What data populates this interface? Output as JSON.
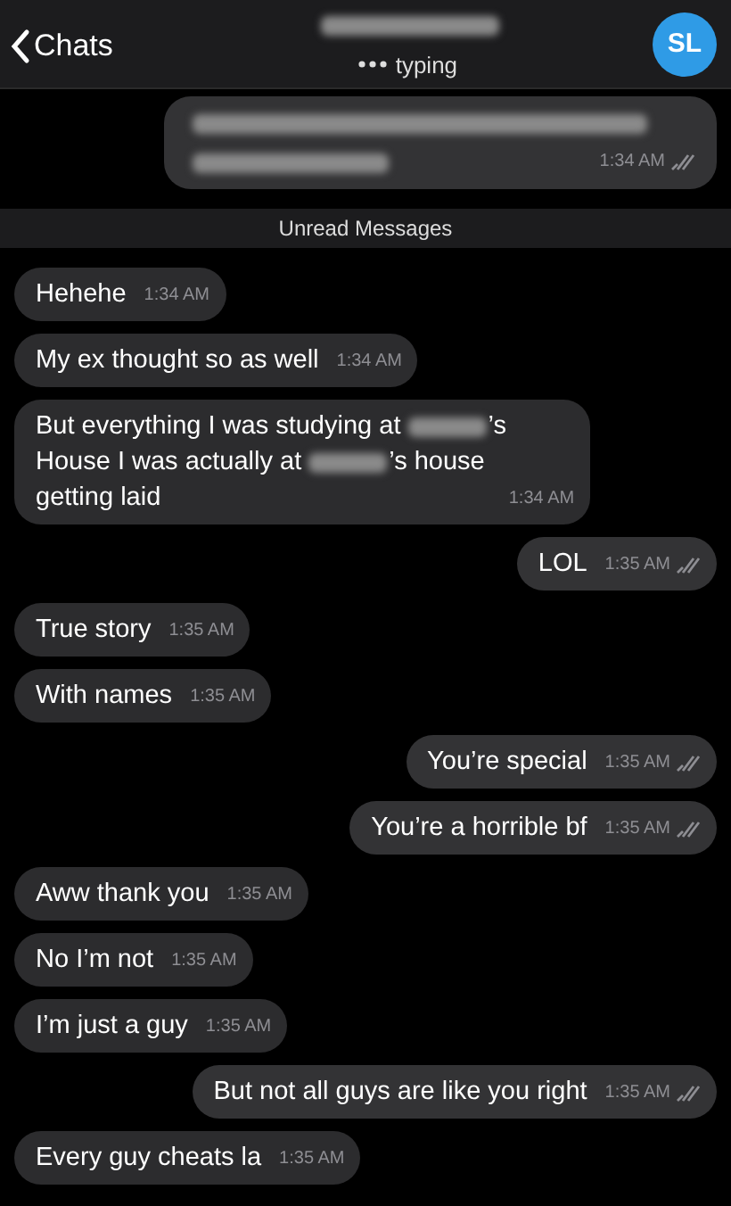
{
  "header": {
    "back_label": "Chats",
    "title": {
      "kind": "redacted"
    },
    "status": "typing",
    "avatar": {
      "initials": "SL",
      "color": "#2f9be6"
    }
  },
  "messages": [
    {
      "kind": "outgoing",
      "parts": [
        {
          "kind": "redacted"
        },
        {
          "kind": "redacted"
        }
      ],
      "time": "1:34 AM",
      "read": true
    },
    {
      "kind": "divider",
      "text": "Unread Messages"
    },
    {
      "kind": "incoming",
      "parts": [
        {
          "kind": "text",
          "text": "Hehehe"
        }
      ],
      "time": "1:34 AM"
    },
    {
      "kind": "incoming",
      "parts": [
        {
          "kind": "text",
          "text": "My ex thought so as well"
        }
      ],
      "time": "1:34 AM"
    },
    {
      "kind": "incoming",
      "parts": [
        {
          "kind": "text",
          "text": "But everything I was studying at"
        },
        {
          "kind": "redacted"
        },
        {
          "kind": "text",
          "text": "’s"
        },
        {
          "kind": "text",
          "text": "House I was actually at"
        },
        {
          "kind": "redacted"
        },
        {
          "kind": "text",
          "text": "’s house"
        },
        {
          "kind": "text",
          "text": "getting laid"
        }
      ],
      "time": "1:34 AM"
    },
    {
      "kind": "outgoing",
      "parts": [
        {
          "kind": "text",
          "text": "LOL"
        }
      ],
      "time": "1:35 AM",
      "read": true
    },
    {
      "kind": "incoming",
      "parts": [
        {
          "kind": "text",
          "text": "True story"
        }
      ],
      "time": "1:35 AM"
    },
    {
      "kind": "incoming",
      "parts": [
        {
          "kind": "text",
          "text": "With names"
        }
      ],
      "time": "1:35 AM"
    },
    {
      "kind": "outgoing",
      "parts": [
        {
          "kind": "text",
          "text": "You’re special"
        }
      ],
      "time": "1:35 AM",
      "read": true
    },
    {
      "kind": "outgoing",
      "parts": [
        {
          "kind": "text",
          "text": "You’re a horrible bf"
        }
      ],
      "time": "1:35 AM",
      "read": true
    },
    {
      "kind": "incoming",
      "parts": [
        {
          "kind": "text",
          "text": "Aww thank you"
        }
      ],
      "time": "1:35 AM"
    },
    {
      "kind": "incoming",
      "parts": [
        {
          "kind": "text",
          "text": "No I’m not"
        }
      ],
      "time": "1:35 AM"
    },
    {
      "kind": "incoming",
      "parts": [
        {
          "kind": "text",
          "text": "I’m just a guy"
        }
      ],
      "time": "1:35 AM"
    },
    {
      "kind": "outgoing",
      "parts": [
        {
          "kind": "text",
          "text": "But not all guys are like you right"
        }
      ],
      "time": "1:35 AM",
      "read": true
    },
    {
      "kind": "incoming",
      "parts": [
        {
          "kind": "text",
          "text": "Every guy cheats la"
        }
      ],
      "time": "1:35 AM"
    }
  ]
}
